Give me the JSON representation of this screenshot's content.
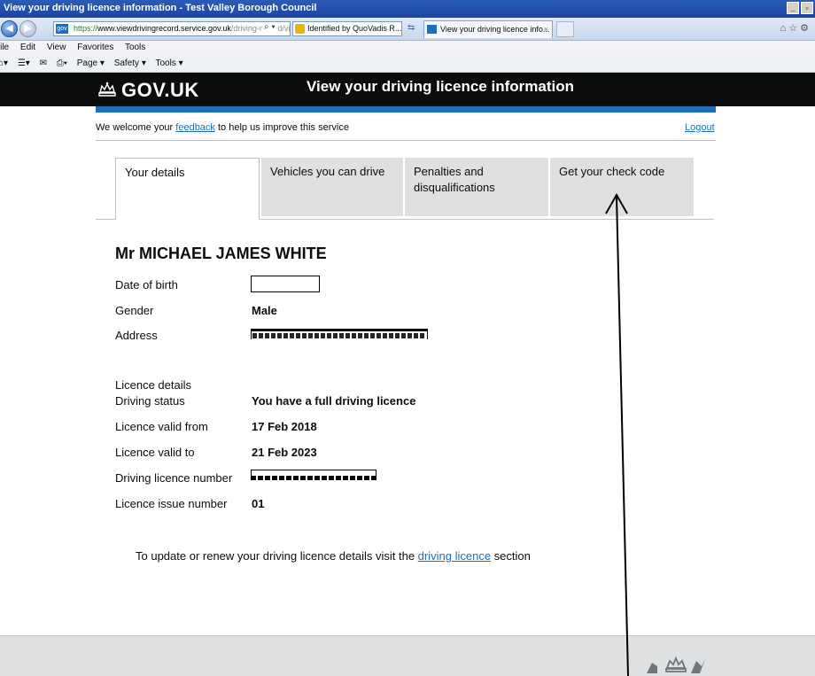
{
  "browser": {
    "window_title": "View your driving licence information - Test Valley Borough Council",
    "url_prefix": "https://",
    "url_host": "www.viewdrivingrecord.service.gov.uk",
    "url_path": "/driving-record/vie",
    "cert_label": "Identified by QuoVadis R...",
    "tab_label": "View your driving licence info...",
    "tab_close": "×",
    "menu": [
      "File",
      "Edit",
      "View",
      "Favorites",
      "Tools"
    ],
    "command_bar": [
      "Page ▾",
      "Safety ▾",
      "Tools ▾"
    ]
  },
  "header": {
    "logo_text": "GOV.UK",
    "service_name": "View your driving licence information"
  },
  "phase_banner": {
    "prefix": "We welcome your ",
    "feedback_link": "feedback",
    "suffix": " to help us improve this service",
    "logout": "Logout"
  },
  "tabs": [
    {
      "label": "Your details",
      "active": true
    },
    {
      "label": "Vehicles you can drive",
      "active": false
    },
    {
      "label": "Penalties and disqualifications",
      "active": false
    },
    {
      "label": "Get your check code",
      "active": false
    }
  ],
  "person": {
    "name": "Mr MICHAEL JAMES WHITE",
    "dob_label": "Date of birth",
    "gender_label": "Gender",
    "gender_value": "Male",
    "address_label": "Address"
  },
  "licence": {
    "section_label": "Licence details",
    "status_label": "Driving status",
    "status_value": "You have a full driving licence",
    "valid_from_label": "Licence valid from",
    "valid_from_value": "17 Feb 2018",
    "valid_to_label": "Licence valid to",
    "valid_to_value": "21 Feb 2023",
    "number_label": "Driving licence number",
    "issue_label": "Licence issue number",
    "issue_value": "01"
  },
  "update_note": {
    "prefix": "To update or renew your driving licence details visit the ",
    "link": "driving licence",
    "suffix": " section"
  },
  "colors": {
    "header_bg": "#0b0c0c",
    "stripe": "#1d70b8",
    "tab_inactive": "#dee0e2",
    "link": "#1d70b8"
  }
}
